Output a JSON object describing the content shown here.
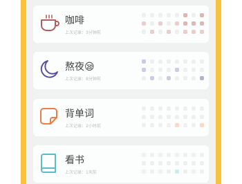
{
  "habits": [
    {
      "title": "咖啡",
      "subtitle": "上次记录：3分钟前",
      "icon": "coffee-cup-icon",
      "color": "#b35e5e",
      "grid": [
        [
          0,
          0,
          0,
          0,
          0,
          2,
          0,
          2
        ],
        [
          1,
          0,
          1,
          0,
          1,
          2,
          2,
          2
        ],
        [
          0,
          1,
          0,
          1,
          0,
          1,
          1,
          1
        ]
      ]
    },
    {
      "title": "熬夜😪",
      "subtitle": "上次记录：8分钟前",
      "icon": "moon-icon",
      "color": "#5a4ea0",
      "grid": [
        [
          1,
          0,
          0,
          0,
          0,
          0,
          0,
          0
        ],
        [
          1,
          0,
          0,
          0,
          1,
          0,
          0,
          0
        ],
        [
          0,
          1,
          0,
          1,
          0,
          0,
          0,
          2
        ]
      ]
    },
    {
      "title": "背单词",
      "subtitle": "上次记录：2小时前",
      "icon": "sticky-note-icon",
      "color": "#ee7a45",
      "grid": [
        [
          0,
          0,
          0,
          0,
          0,
          0,
          0,
          0
        ],
        [
          0,
          0,
          0,
          0,
          0,
          0,
          0,
          0
        ],
        [
          0,
          0,
          0,
          0,
          1,
          0,
          0,
          1
        ]
      ]
    },
    {
      "title": "看书",
      "subtitle": "上次记录：1天前",
      "icon": "book-icon",
      "color": "#5bbcc8",
      "grid": [
        [
          0,
          0,
          0,
          0,
          0,
          0,
          0,
          0
        ],
        [
          0,
          0,
          0,
          0,
          0,
          0,
          0,
          0
        ],
        [
          0,
          0,
          0,
          0,
          1,
          0,
          0,
          0
        ]
      ]
    }
  ]
}
